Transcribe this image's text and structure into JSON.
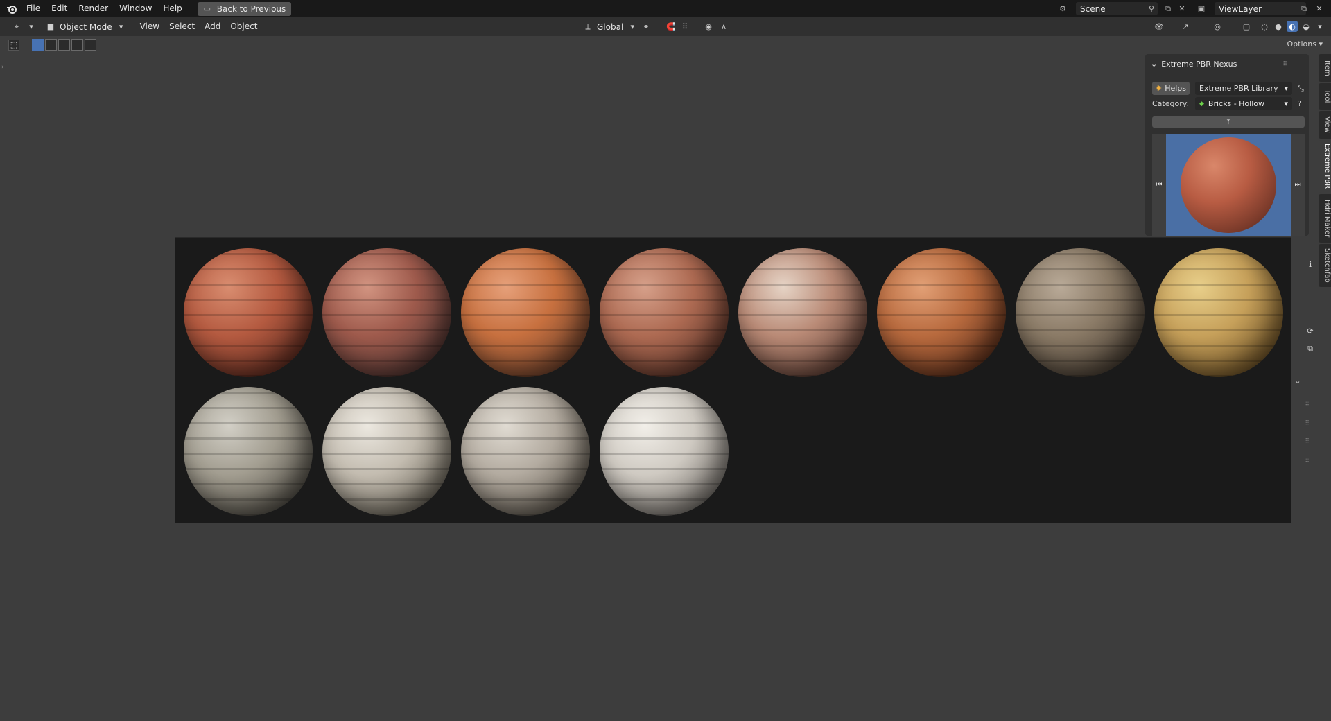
{
  "topbar": {
    "menus": [
      "File",
      "Edit",
      "Render",
      "Window",
      "Help"
    ],
    "back_button": "Back to Previous",
    "scene": "Scene",
    "view_layer": "ViewLayer"
  },
  "header": {
    "mode": "Object Mode",
    "menus": [
      "View",
      "Select",
      "Add",
      "Object"
    ],
    "orientation": "Global"
  },
  "options_label": "Options",
  "panel": {
    "title": "Extreme PBR Nexus",
    "helps_label": "Helps",
    "library": "Extreme PBR Library",
    "category_label": "Category:",
    "category": "Bricks - Hollow"
  },
  "side_tabs": [
    "Item",
    "Tool",
    "View",
    "Extreme PBR",
    "Hdri Maker",
    "Sketchfab"
  ],
  "colors": {
    "accent": "#4772b3",
    "preview_bg": "#4a6fa5"
  },
  "materials": [
    {
      "icon": "red-brick-sphere"
    },
    {
      "icon": "red-grey-brick-sphere"
    },
    {
      "icon": "orange-brick-sphere"
    },
    {
      "icon": "rough-red-brick-sphere"
    },
    {
      "icon": "white-mortar-brick-sphere"
    },
    {
      "icon": "ribbed-orange-brick-sphere"
    },
    {
      "icon": "ribbed-grey-brick-sphere"
    },
    {
      "icon": "yellow-brick-sphere"
    },
    {
      "icon": "grey-painted-brick-sphere"
    },
    {
      "icon": "white-large-brick-sphere"
    },
    {
      "icon": "white-grey-brick-sphere"
    },
    {
      "icon": "white-brick-sphere"
    }
  ]
}
